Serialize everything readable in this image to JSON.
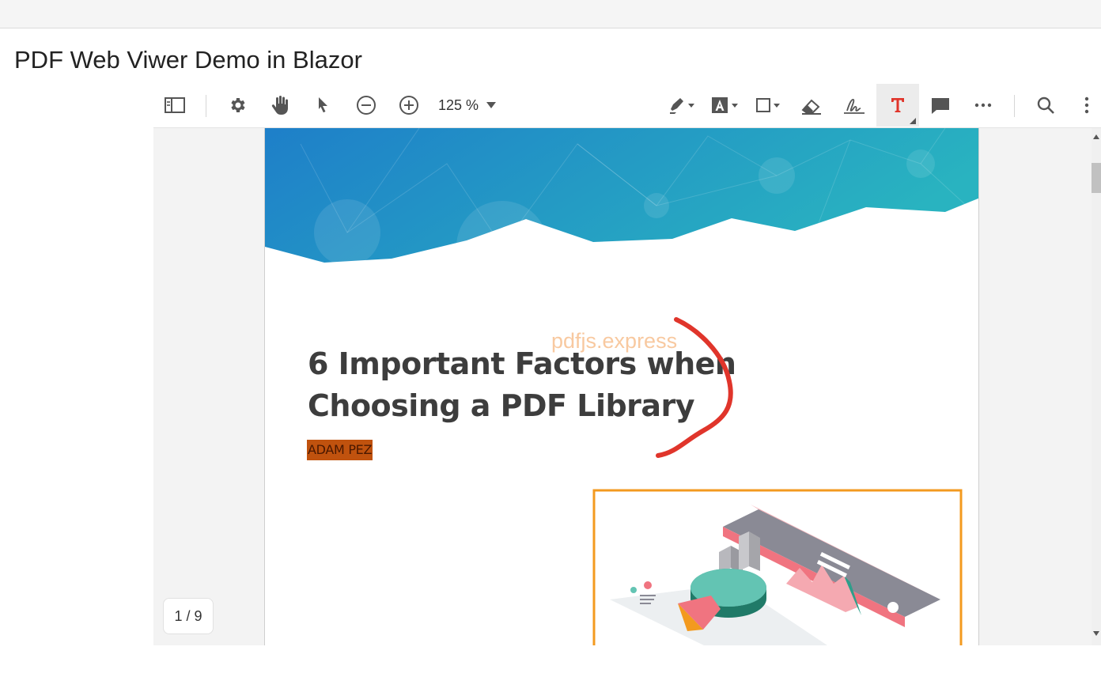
{
  "page": {
    "title": "PDF Web Viwer Demo in Blazor"
  },
  "toolbar": {
    "zoom_value": "125 %",
    "left_tools": [
      "sidebar-toggle",
      "settings",
      "pan",
      "select",
      "zoom-out",
      "zoom-in"
    ],
    "right_tools": [
      "highlight",
      "free-text",
      "shape",
      "eraser",
      "signature",
      "text-tool",
      "comment",
      "more",
      "search",
      "menu"
    ],
    "active_tool": "text-tool"
  },
  "document": {
    "title_line1": "6 Important Factors when",
    "title_line2": "Choosing a PDF Library",
    "watermark": "pdfjs.express",
    "author": "ADAM PEZ"
  },
  "pagination": {
    "label": "1 / 9",
    "current": 1,
    "total": 9
  },
  "colors": {
    "banner_start": "#1e7fc9",
    "banner_end": "#29b3c0",
    "ink_annotation": "#e0352b",
    "highlight": "#c0520e",
    "frame_border": "#f39a1f",
    "active_tool_icon": "#e0352b"
  }
}
